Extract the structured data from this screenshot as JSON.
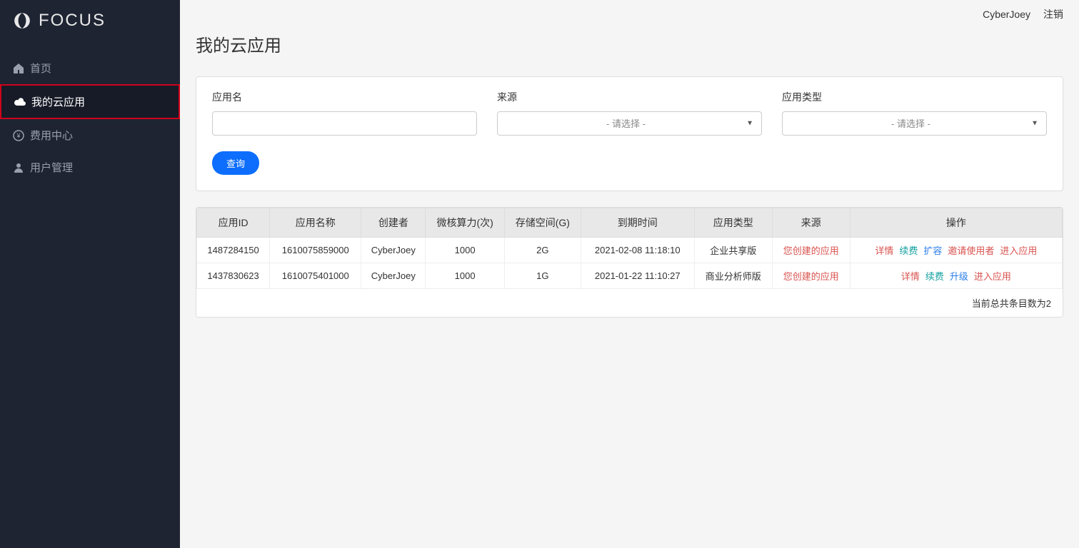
{
  "brand": {
    "name": "FOCUS"
  },
  "sidebar": {
    "items": [
      {
        "label": "首页",
        "icon": "home-icon"
      },
      {
        "label": "我的云应用",
        "icon": "cloud-icon"
      },
      {
        "label": "费用中心",
        "icon": "yen-icon"
      },
      {
        "label": "用户管理",
        "icon": "user-icon"
      }
    ]
  },
  "header": {
    "username": "CyberJoey",
    "logout": "注销"
  },
  "page": {
    "title": "我的云应用"
  },
  "filters": {
    "appname_label": "应用名",
    "source_label": "来源",
    "source_placeholder": "- 请选择 -",
    "apptype_label": "应用类型",
    "apptype_placeholder": "- 请选择 -",
    "query_button": "查询"
  },
  "table": {
    "columns": [
      "应用ID",
      "应用名称",
      "创建者",
      "微核算力(次)",
      "存储空间(G)",
      "到期时间",
      "应用类型",
      "来源",
      "操作"
    ],
    "rows": [
      {
        "id": "1487284150",
        "name": "1610075859000",
        "creator": "CyberJoey",
        "compute": "1000",
        "storage": "2G",
        "expires": "2021-02-08 11:18:10",
        "apptype": "企业共享版",
        "source": "您创建的应用",
        "actions": [
          {
            "label": "详情",
            "cls": "link-red"
          },
          {
            "label": "续费",
            "cls": "link-teal"
          },
          {
            "label": "扩容",
            "cls": "link-blue"
          },
          {
            "label": "邀请使用者",
            "cls": "link-red"
          },
          {
            "label": "进入应用",
            "cls": "link-red"
          }
        ]
      },
      {
        "id": "1437830623",
        "name": "1610075401000",
        "creator": "CyberJoey",
        "compute": "1000",
        "storage": "1G",
        "expires": "2021-01-22 11:10:27",
        "apptype": "商业分析师版",
        "source": "您创建的应用",
        "actions": [
          {
            "label": "详情",
            "cls": "link-red"
          },
          {
            "label": "续费",
            "cls": "link-teal"
          },
          {
            "label": "升级",
            "cls": "link-blue"
          },
          {
            "label": "进入应用",
            "cls": "link-red"
          }
        ]
      }
    ],
    "footer": "当前总共条目数为2"
  }
}
